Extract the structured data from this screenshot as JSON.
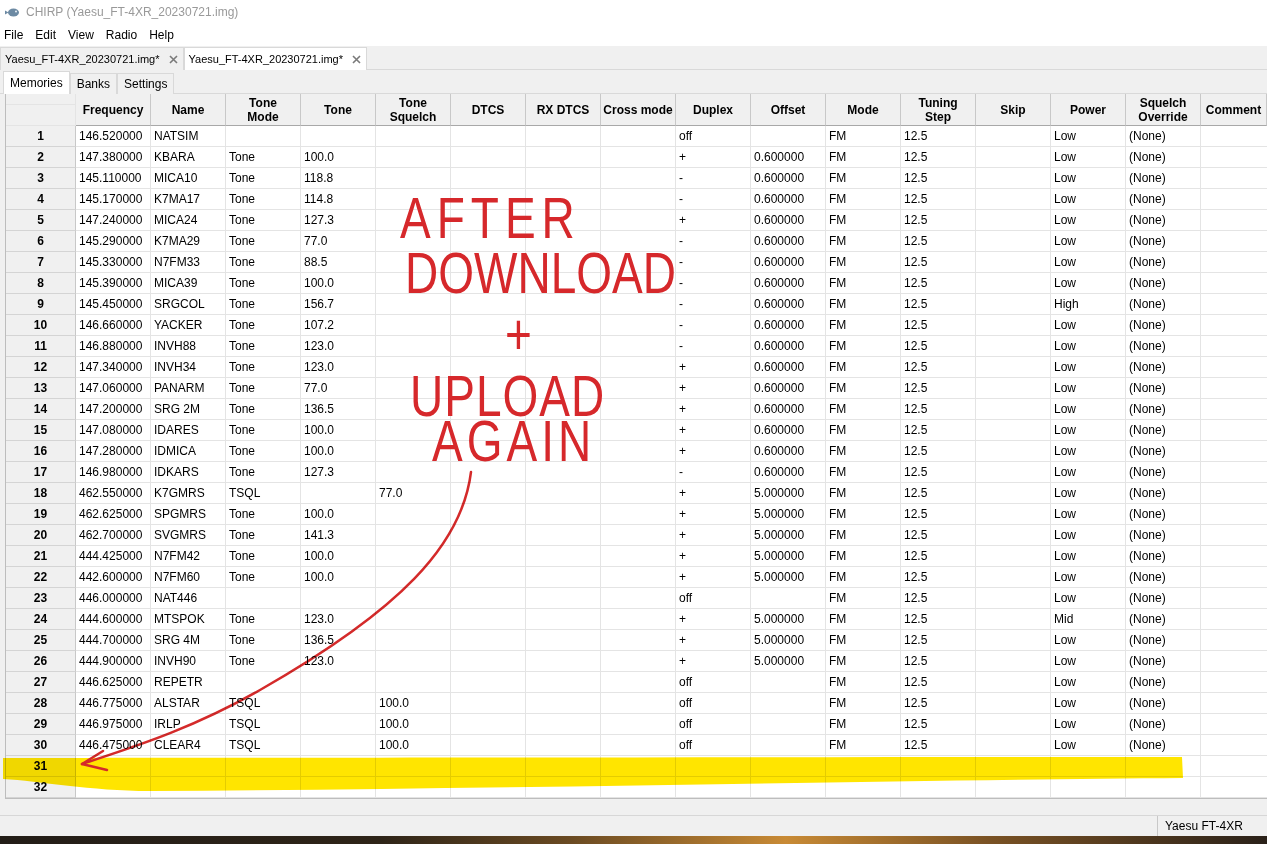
{
  "window": {
    "title": "CHIRP (Yaesu_FT-4XR_20230721.img)"
  },
  "menu": [
    "File",
    "Edit",
    "View",
    "Radio",
    "Help"
  ],
  "file_tabs": [
    {
      "label": "Yaesu_FT-4XR_20230721.img*",
      "selected": false
    },
    {
      "label": "Yaesu_FT-4XR_20230721.img*",
      "selected": true
    }
  ],
  "view_tabs": [
    {
      "label": "Memories",
      "selected": true
    },
    {
      "label": "Banks",
      "selected": false
    },
    {
      "label": "Settings",
      "selected": false
    }
  ],
  "table": {
    "columns": [
      "Frequency",
      "Name",
      "Tone\nMode",
      "Tone",
      "Tone\nSquelch",
      "DTCS",
      "RX DTCS",
      "Cross mode",
      "Duplex",
      "Offset",
      "Mode",
      "Tuning\nStep",
      "Skip",
      "Power",
      "Squelch\nOverride",
      "Comment"
    ],
    "rows": [
      {
        "number": "1",
        "cells": [
          "146.520000",
          "NATSIM",
          null,
          null,
          null,
          null,
          null,
          null,
          "off",
          null,
          "FM",
          "12.5",
          null,
          "Low",
          "(None)"
        ]
      },
      {
        "number": "2",
        "cells": [
          "147.380000",
          "KBARA",
          "Tone",
          "100.0",
          null,
          null,
          null,
          null,
          "+",
          "0.600000",
          "FM",
          "12.5",
          null,
          "Low",
          "(None)"
        ]
      },
      {
        "number": "3",
        "cells": [
          "145.110000",
          "MICA10",
          "Tone",
          "118.8",
          null,
          null,
          null,
          null,
          "-",
          "0.600000",
          "FM",
          "12.5",
          null,
          "Low",
          "(None)"
        ]
      },
      {
        "number": "4",
        "cells": [
          "145.170000",
          "K7MA17",
          "Tone",
          "114.8",
          null,
          null,
          null,
          null,
          "-",
          "0.600000",
          "FM",
          "12.5",
          null,
          "Low",
          "(None)"
        ]
      },
      {
        "number": "5",
        "cells": [
          "147.240000",
          "MICA24",
          "Tone",
          "127.3",
          null,
          null,
          null,
          null,
          "+",
          "0.600000",
          "FM",
          "12.5",
          null,
          "Low",
          "(None)"
        ]
      },
      {
        "number": "6",
        "cells": [
          "145.290000",
          "K7MA29",
          "Tone",
          "77.0",
          null,
          null,
          null,
          null,
          "-",
          "0.600000",
          "FM",
          "12.5",
          null,
          "Low",
          "(None)"
        ]
      },
      {
        "number": "7",
        "cells": [
          "145.330000",
          "N7FM33",
          "Tone",
          "88.5",
          null,
          null,
          null,
          null,
          "-",
          "0.600000",
          "FM",
          "12.5",
          null,
          "Low",
          "(None)"
        ]
      },
      {
        "number": "8",
        "cells": [
          "145.390000",
          "MICA39",
          "Tone",
          "100.0",
          null,
          null,
          null,
          null,
          "-",
          "0.600000",
          "FM",
          "12.5",
          null,
          "Low",
          "(None)"
        ]
      },
      {
        "number": "9",
        "cells": [
          "145.450000",
          "SRGCOL",
          "Tone",
          "156.7",
          null,
          null,
          null,
          null,
          "-",
          "0.600000",
          "FM",
          "12.5",
          null,
          "High",
          "(None)"
        ]
      },
      {
        "number": "10",
        "cells": [
          "146.660000",
          "YACKER",
          "Tone",
          "107.2",
          null,
          null,
          null,
          null,
          "-",
          "0.600000",
          "FM",
          "12.5",
          null,
          "Low",
          "(None)"
        ]
      },
      {
        "number": "11",
        "cells": [
          "146.880000",
          "INVH88",
          "Tone",
          "123.0",
          null,
          null,
          null,
          null,
          "-",
          "0.600000",
          "FM",
          "12.5",
          null,
          "Low",
          "(None)"
        ]
      },
      {
        "number": "12",
        "cells": [
          "147.340000",
          "INVH34",
          "Tone",
          "123.0",
          null,
          null,
          null,
          null,
          "+",
          "0.600000",
          "FM",
          "12.5",
          null,
          "Low",
          "(None)"
        ]
      },
      {
        "number": "13",
        "cells": [
          "147.060000",
          "PANARM",
          "Tone",
          "77.0",
          null,
          null,
          null,
          null,
          "+",
          "0.600000",
          "FM",
          "12.5",
          null,
          "Low",
          "(None)"
        ]
      },
      {
        "number": "14",
        "cells": [
          "147.200000",
          "SRG 2M",
          "Tone",
          "136.5",
          null,
          null,
          null,
          null,
          "+",
          "0.600000",
          "FM",
          "12.5",
          null,
          "Low",
          "(None)"
        ]
      },
      {
        "number": "15",
        "cells": [
          "147.080000",
          "IDARES",
          "Tone",
          "100.0",
          null,
          null,
          null,
          null,
          "+",
          "0.600000",
          "FM",
          "12.5",
          null,
          "Low",
          "(None)"
        ]
      },
      {
        "number": "16",
        "cells": [
          "147.280000",
          "IDMICA",
          "Tone",
          "100.0",
          null,
          null,
          null,
          null,
          "+",
          "0.600000",
          "FM",
          "12.5",
          null,
          "Low",
          "(None)"
        ]
      },
      {
        "number": "17",
        "cells": [
          "146.980000",
          "IDKARS",
          "Tone",
          "127.3",
          null,
          null,
          null,
          null,
          "-",
          "0.600000",
          "FM",
          "12.5",
          null,
          "Low",
          "(None)"
        ]
      },
      {
        "number": "18",
        "cells": [
          "462.550000",
          "K7GMRS",
          "TSQL",
          null,
          "77.0",
          null,
          null,
          null,
          "+",
          "5.000000",
          "FM",
          "12.5",
          null,
          "Low",
          "(None)"
        ]
      },
      {
        "number": "19",
        "cells": [
          "462.625000",
          "SPGMRS",
          "Tone",
          "100.0",
          null,
          null,
          null,
          null,
          "+",
          "5.000000",
          "FM",
          "12.5",
          null,
          "Low",
          "(None)"
        ]
      },
      {
        "number": "20",
        "cells": [
          "462.700000",
          "SVGMRS",
          "Tone",
          "141.3",
          null,
          null,
          null,
          null,
          "+",
          "5.000000",
          "FM",
          "12.5",
          null,
          "Low",
          "(None)"
        ]
      },
      {
        "number": "21",
        "cells": [
          "444.425000",
          "N7FM42",
          "Tone",
          "100.0",
          null,
          null,
          null,
          null,
          "+",
          "5.000000",
          "FM",
          "12.5",
          null,
          "Low",
          "(None)"
        ]
      },
      {
        "number": "22",
        "cells": [
          "442.600000",
          "N7FM60",
          "Tone",
          "100.0",
          null,
          null,
          null,
          null,
          "+",
          "5.000000",
          "FM",
          "12.5",
          null,
          "Low",
          "(None)"
        ]
      },
      {
        "number": "23",
        "cells": [
          "446.000000",
          "NAT446",
          null,
          null,
          null,
          null,
          null,
          null,
          "off",
          null,
          "FM",
          "12.5",
          null,
          "Low",
          "(None)"
        ]
      },
      {
        "number": "24",
        "cells": [
          "444.600000",
          "MTSPOK",
          "Tone",
          "123.0",
          null,
          null,
          null,
          null,
          "+",
          "5.000000",
          "FM",
          "12.5",
          null,
          "Mid",
          "(None)"
        ]
      },
      {
        "number": "25",
        "cells": [
          "444.700000",
          "SRG 4M",
          "Tone",
          "136.5",
          null,
          null,
          null,
          null,
          "+",
          "5.000000",
          "FM",
          "12.5",
          null,
          "Low",
          "(None)"
        ]
      },
      {
        "number": "26",
        "cells": [
          "444.900000",
          "INVH90",
          "Tone",
          "123.0",
          null,
          null,
          null,
          null,
          "+",
          "5.000000",
          "FM",
          "12.5",
          null,
          "Low",
          "(None)"
        ]
      },
      {
        "number": "27",
        "cells": [
          "446.625000",
          "REPETR",
          null,
          null,
          null,
          null,
          null,
          null,
          "off",
          null,
          "FM",
          "12.5",
          null,
          "Low",
          "(None)"
        ]
      },
      {
        "number": "28",
        "cells": [
          "446.775000",
          "ALSTAR",
          "TSQL",
          null,
          "100.0",
          null,
          null,
          null,
          "off",
          null,
          "FM",
          "12.5",
          null,
          "Low",
          "(None)"
        ]
      },
      {
        "number": "29",
        "cells": [
          "446.975000",
          "IRLP",
          "TSQL",
          null,
          "100.0",
          null,
          null,
          null,
          "off",
          null,
          "FM",
          "12.5",
          null,
          "Low",
          "(None)"
        ]
      },
      {
        "number": "30",
        "cells": [
          "446.475000",
          "CLEAR4",
          "TSQL",
          null,
          "100.0",
          null,
          null,
          null,
          "off",
          null,
          "FM",
          "12.5",
          null,
          "Low",
          "(None)"
        ]
      },
      {
        "number": "31"
      },
      {
        "number": "32"
      }
    ]
  },
  "status_bar": {
    "text": "Yaesu FT-4XR"
  },
  "annotation": {
    "lines": [
      "AFTER",
      "DOWNLOAD",
      "+",
      "UPLOAD",
      "AGAIN"
    ]
  }
}
